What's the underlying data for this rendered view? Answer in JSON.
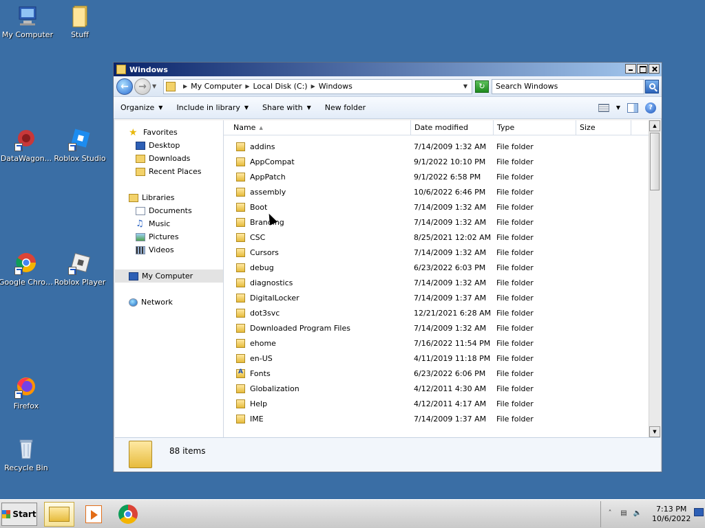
{
  "desktop": {
    "icons": [
      {
        "label": "My Computer",
        "icon": "computer-icon"
      },
      {
        "label": "Stuff",
        "icon": "folder-icon"
      },
      {
        "label": "DataWagon...",
        "icon": "app-shortcut-icon"
      },
      {
        "label": "Roblox Studio",
        "icon": "roblox-studio-icon"
      },
      {
        "label": "Google Chrome",
        "icon": "chrome-icon"
      },
      {
        "label": "Roblox Player",
        "icon": "roblox-player-icon"
      },
      {
        "label": "Firefox",
        "icon": "firefox-icon"
      },
      {
        "label": "Recycle Bin",
        "icon": "recycle-bin-icon"
      }
    ]
  },
  "window": {
    "title": "Windows",
    "address": {
      "crumbs": [
        "My Computer",
        "Local Disk (C:)",
        "Windows"
      ]
    },
    "search": {
      "placeholder": "Search Windows"
    },
    "commands": {
      "organize": "Organize",
      "include": "Include in library",
      "share": "Share with",
      "newfolder": "New folder"
    },
    "nav": {
      "favorites": "Favorites",
      "desktop": "Desktop",
      "downloads": "Downloads",
      "recent": "Recent Places",
      "libraries": "Libraries",
      "documents": "Documents",
      "music": "Music",
      "pictures": "Pictures",
      "videos": "Videos",
      "mycomputer": "My Computer",
      "network": "Network"
    },
    "columns": {
      "name": "Name",
      "date": "Date modified",
      "type": "Type",
      "size": "Size"
    },
    "rows": [
      {
        "name": "addins",
        "date": "7/14/2009 1:32 AM",
        "type": "File folder"
      },
      {
        "name": "AppCompat",
        "date": "9/1/2022 10:10 PM",
        "type": "File folder"
      },
      {
        "name": "AppPatch",
        "date": "9/1/2022 6:58 PM",
        "type": "File folder"
      },
      {
        "name": "assembly",
        "date": "10/6/2022 6:46 PM",
        "type": "File folder"
      },
      {
        "name": "Boot",
        "date": "7/14/2009 1:32 AM",
        "type": "File folder"
      },
      {
        "name": "Branding",
        "date": "7/14/2009 1:32 AM",
        "type": "File folder"
      },
      {
        "name": "CSC",
        "date": "8/25/2021 12:02 AM",
        "type": "File folder"
      },
      {
        "name": "Cursors",
        "date": "7/14/2009 1:32 AM",
        "type": "File folder"
      },
      {
        "name": "debug",
        "date": "6/23/2022 6:03 PM",
        "type": "File folder"
      },
      {
        "name": "diagnostics",
        "date": "7/14/2009 1:32 AM",
        "type": "File folder"
      },
      {
        "name": "DigitalLocker",
        "date": "7/14/2009 1:37 AM",
        "type": "File folder"
      },
      {
        "name": "dot3svc",
        "date": "12/21/2021 6:28 AM",
        "type": "File folder"
      },
      {
        "name": "Downloaded Program Files",
        "date": "7/14/2009 1:32 AM",
        "type": "File folder"
      },
      {
        "name": "ehome",
        "date": "7/16/2022 11:54 PM",
        "type": "File folder"
      },
      {
        "name": "en-US",
        "date": "4/11/2019 11:18 PM",
        "type": "File folder"
      },
      {
        "name": "Fonts",
        "date": "6/23/2022 6:06 PM",
        "type": "File folder"
      },
      {
        "name": "Globalization",
        "date": "4/12/2011 4:30 AM",
        "type": "File folder"
      },
      {
        "name": "Help",
        "date": "4/12/2011 4:17 AM",
        "type": "File folder"
      },
      {
        "name": "IME",
        "date": "7/14/2009 1:37 AM",
        "type": "File folder"
      }
    ],
    "status": {
      "count": "88 items"
    }
  },
  "taskbar": {
    "start": "Start",
    "time": "7:13 PM",
    "date": "10/6/2022"
  }
}
